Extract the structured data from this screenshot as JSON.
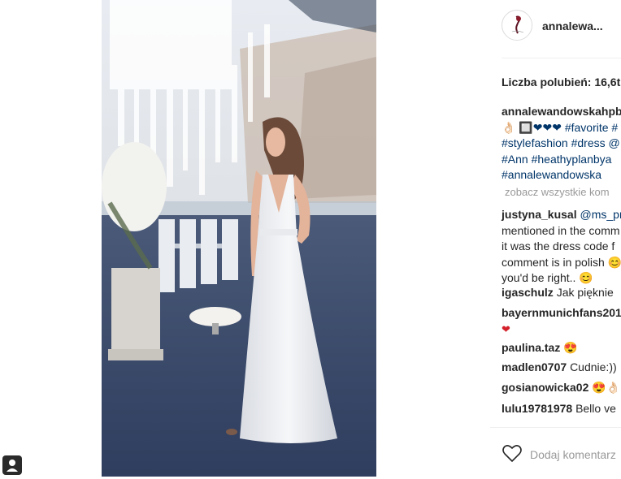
{
  "post": {
    "username": "annalewa...",
    "likes_label": "Liczba polubień: 16,6t",
    "caption": {
      "username": "annalewandowskahpb",
      "lines": [
        "👌🏻 🔲❤❤❤ #favorite #",
        "#stylefashion #dress @",
        "#Ann #heathyplanbya",
        "#annalewandowska"
      ]
    },
    "view_all": "zobacz wszystkie kom",
    "comments": [
      {
        "user": "justyna_kusal",
        "lines": [
          "@ms_pr",
          "mentioned in the comm",
          "it was the dress code f",
          "comment is in polish 😊",
          "you'd be right.. 😊"
        ]
      },
      {
        "user": "igaschulz",
        "lines": [
          "Jak pięknie"
        ]
      },
      {
        "user": "bayernmunichfans201",
        "lines": [
          "❤"
        ]
      },
      {
        "user": "paulina.taz",
        "lines": [
          "😍"
        ]
      },
      {
        "user": "madlen0707",
        "lines": [
          "Cudnie:))"
        ]
      },
      {
        "user": "gosianowicka02",
        "lines": [
          "😍👌🏻👌"
        ]
      },
      {
        "user": "lulu19781978",
        "lines": [
          "Bello ve"
        ]
      }
    ],
    "add_comment_placeholder": "Dodaj komentarz"
  },
  "colors": {
    "link": "#003569",
    "muted": "#999999",
    "text": "#262626",
    "heart_red": "#d4202a"
  },
  "icons": [
    "like-heart-icon",
    "avatar-logo",
    "profile-corner-icon"
  ]
}
